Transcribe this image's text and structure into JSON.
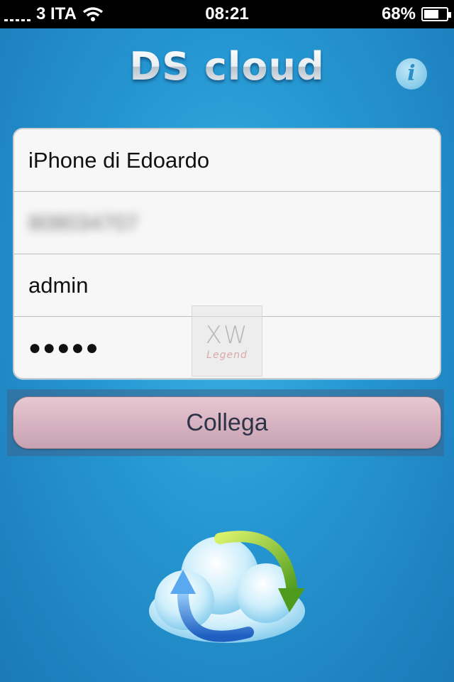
{
  "status_bar": {
    "carrier": "3 ITA",
    "time": "08:21",
    "battery_percent": "68%",
    "battery_level": 0.68
  },
  "app": {
    "title": "DS cloud",
    "info_label": "i"
  },
  "form": {
    "device_name": "iPhone di Edoardo",
    "server_address": "808034707",
    "username": "admin",
    "password_mask": "●●●●●"
  },
  "connect_button": {
    "label": "Collega"
  },
  "watermark": {
    "line1": "XW",
    "line2": "Legend"
  },
  "icons": {
    "wifi": "wifi-icon",
    "battery": "battery-icon",
    "info": "info-icon",
    "cloud": "cloud-sync-icon"
  },
  "colors": {
    "background": "#2596d1",
    "button": "#d8b3c1",
    "button_text": "#2e3448"
  }
}
